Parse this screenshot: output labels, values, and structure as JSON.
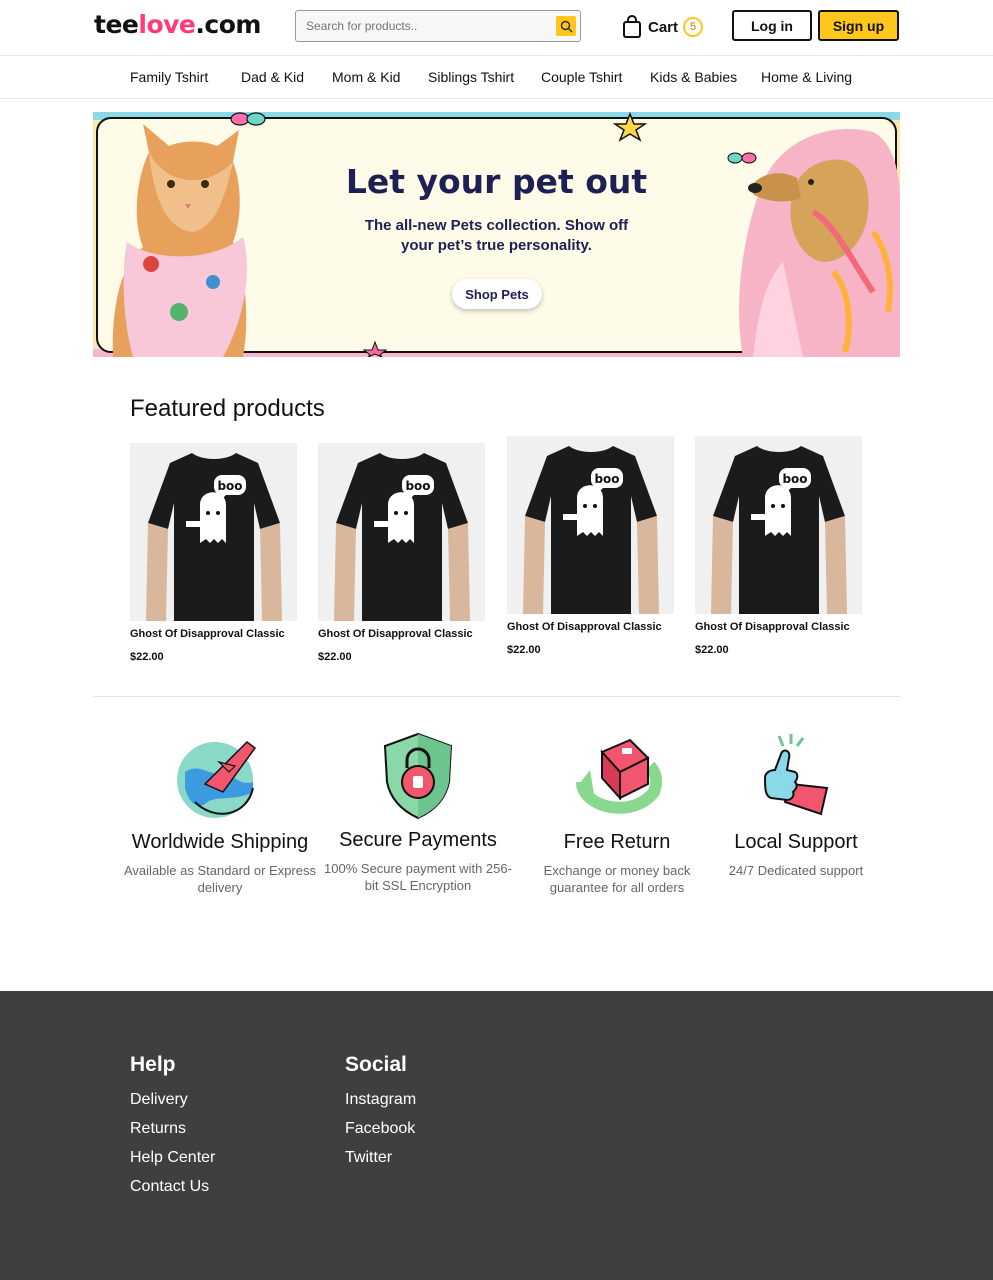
{
  "header": {
    "logo_part1": "tee",
    "logo_part2": "love",
    "logo_part3": ".com",
    "search_placeholder": "Search for products..",
    "cart_label": "Cart",
    "cart_count": "5",
    "login_label": "Log in",
    "signup_label": "Sign up"
  },
  "nav": {
    "items": [
      "Family Tshirt",
      "Dad & Kid",
      "Mom & Kid",
      "Siblings Tshirt",
      "Couple Tshirt",
      "Kids & Babies",
      "Home & Living"
    ]
  },
  "banner": {
    "title": "Let your pet out",
    "subtitle": "The all-new Pets collection. Show off your pet’s true personality.",
    "button": "Shop Pets"
  },
  "featured": {
    "title": "Featured products",
    "products": [
      {
        "name": "Ghost Of Disapproval Classic",
        "price": "$22.00",
        "print_text": "boo"
      },
      {
        "name": "Ghost Of Disapproval Classic",
        "price": "$22.00",
        "print_text": "boo"
      },
      {
        "name": "Ghost Of Disapproval Classic",
        "price": "$22.00",
        "print_text": "boo"
      },
      {
        "name": "Ghost Of Disapproval Classic",
        "price": "$22.00",
        "print_text": "boo"
      }
    ]
  },
  "features": [
    {
      "title": "Worldwide Shipping",
      "desc": "Available as Standard or Express delivery",
      "icon": "globe-plane-icon"
    },
    {
      "title": "Secure Payments",
      "desc": "100% Secure payment with 256-bit SSL Encryption",
      "icon": "shield-lock-icon"
    },
    {
      "title": "Free Return",
      "desc": "Exchange or money back guarantee for all orders",
      "icon": "return-box-icon"
    },
    {
      "title": "Local Support",
      "desc": "24/7 Dedicated support",
      "icon": "thumbs-up-icon"
    }
  ],
  "footer": {
    "help": {
      "title": "Help",
      "links": [
        "Delivery",
        "Returns",
        "Help Center",
        "Contact Us"
      ]
    },
    "social": {
      "title": "Social",
      "links": [
        "Instagram",
        "Facebook",
        "Twitter"
      ]
    }
  },
  "colors": {
    "accent": "#ffc61b",
    "brand_pink": "#ff3b7a",
    "navy": "#1d1f55",
    "footer_bg": "#3f3f3f"
  }
}
